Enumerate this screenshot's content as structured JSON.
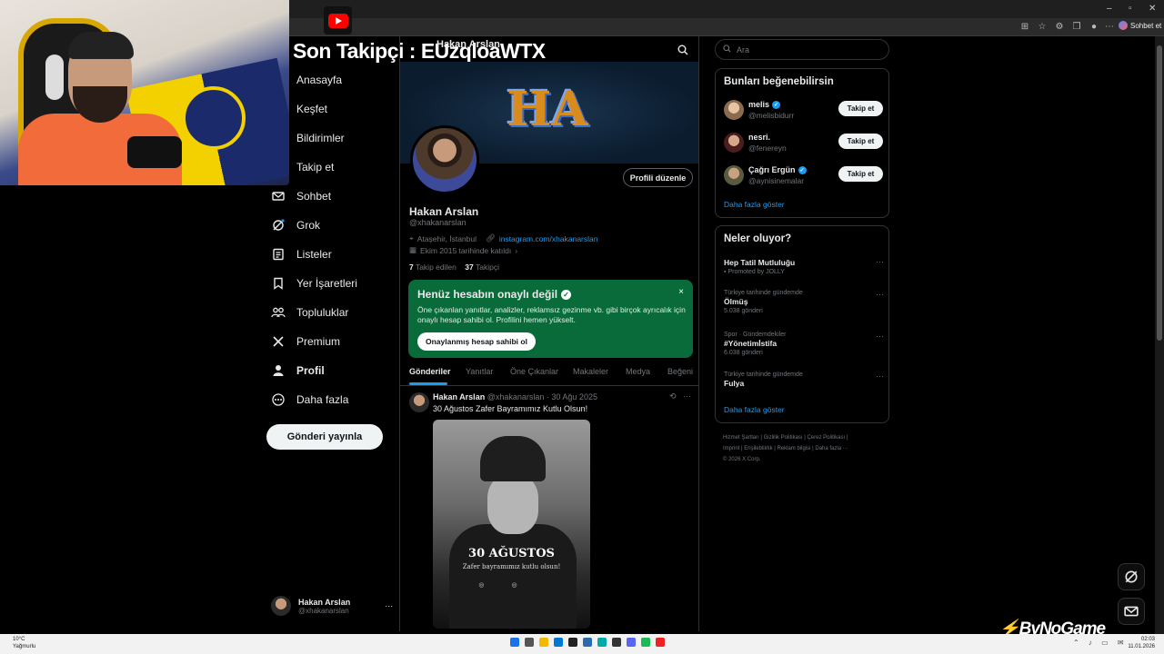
{
  "overlay": {
    "follower_banner": "Son Takipçi : EUzqloaWTX",
    "watermark_pre": "",
    "watermark": "ByNoGame"
  },
  "browser": {
    "sohbet_label": "Sohbet et"
  },
  "nav": {
    "items": [
      {
        "label": "Anasayfa",
        "icon": "home-icon"
      },
      {
        "label": "Keşfet",
        "icon": "search-icon"
      },
      {
        "label": "Bildirimler",
        "icon": "bell-icon"
      },
      {
        "label": "Takip et",
        "icon": "follow-icon"
      },
      {
        "label": "Sohbet",
        "icon": "mail-icon"
      },
      {
        "label": "Grok",
        "icon": "grok-icon"
      },
      {
        "label": "Listeler",
        "icon": "list-icon"
      },
      {
        "label": "Yer İşaretleri",
        "icon": "bookmark-icon"
      },
      {
        "label": "Topluluklar",
        "icon": "communities-icon"
      },
      {
        "label": "Premium",
        "icon": "x-logo-icon"
      },
      {
        "label": "Profil",
        "icon": "person-icon"
      },
      {
        "label": "Daha fazla",
        "icon": "more-circle-icon"
      }
    ],
    "post_button": "Gönderi yayınla",
    "account_name": "Hakan Arslan",
    "account_handle": "@xhakanarslan",
    "account_more": "···"
  },
  "profile": {
    "header_title": "Hakan Arslan",
    "edit_button": "Profili düzenle",
    "name": "Hakan Arslan",
    "handle": "@xhakanarslan",
    "location": "Ataşehir, İstanbul",
    "link": "instagram.com/xhakanarslan",
    "joined": "Ekim 2015 tarihinde katıldı",
    "following_count": "7",
    "following_label": "Takip edilen",
    "followers_count": "37",
    "followers_label": "Takipçi"
  },
  "verify_card": {
    "title": "Henüz hesabın onaylı değil",
    "description": "Öne çıkanlan yanıtlar, analizler, reklamsız gezinme vb. gibi birçok ayrıcalık için onaylı hesap sahibi ol. Profilini hemen yükselt.",
    "button": "Onaylanmış hesap sahibi ol",
    "close": "×"
  },
  "tabs": [
    "Gönderiler",
    "Yanıtlar",
    "Öne Çıkanlar",
    "Makaleler",
    "Medya",
    "Beğeni"
  ],
  "tweet": {
    "author": "Hakan Arslan",
    "handle": "@xhakanarslan",
    "date": "· 30 Ağu 2025",
    "text": "30 Ağustos Zafer Bayramımız Kutlu Olsun!",
    "image_title": "30 AĞUSTOS",
    "image_subtitle": "Zafer bayramımız kutlu olsun!"
  },
  "right": {
    "search_placeholder": "Ara",
    "who_to_follow_title": "Bunları beğenebilirsin",
    "suggestions": [
      {
        "name": "melis",
        "handle": "@melisbidurr",
        "verified": true,
        "button": "Takip et"
      },
      {
        "name": "nesri.",
        "handle": "@fenereyn",
        "verified": false,
        "button": "Takip et"
      },
      {
        "name": "Çağrı Ergün",
        "handle": "@aynisinemalar",
        "verified": true,
        "button": "Takip et"
      }
    ],
    "show_more": "Daha fazla göster",
    "trends_title": "Neler oluyor?",
    "trends": [
      {
        "context": "",
        "title": "Hep Tatil Mutluluğu",
        "count": "Promoted by JOLLY"
      },
      {
        "context": "Türkiye tarihinde gündemde",
        "title": "Ölmüş",
        "count": "5.038 gönderi"
      },
      {
        "context": "Spor · Gündemdekiler",
        "title": "#Yönetimİstifa",
        "count": "6.038 gönderi"
      },
      {
        "context": "Türkiye tarihinde gündemde",
        "title": "Fulya",
        "count": ""
      }
    ],
    "trends_show_more": "Daha fazla göster",
    "footer_line1": "Hizmet Şartları  |  Gizlilik Politikası  |  Çerez Politikası  |",
    "footer_line2": "Imprint  |  Erişilebilirlik  |  Reklam bilgisi  |  Daha fazla ···",
    "footer_line3": "© 2026 X Corp."
  },
  "taskbar": {
    "temp": "10°C",
    "weather": "Yağmurlu",
    "time": "02:03",
    "date": "11.01.2026"
  },
  "colors": {
    "accent": "#1d9bf0",
    "verify_card_bg": "#0a6b3a",
    "background": "#000000"
  }
}
